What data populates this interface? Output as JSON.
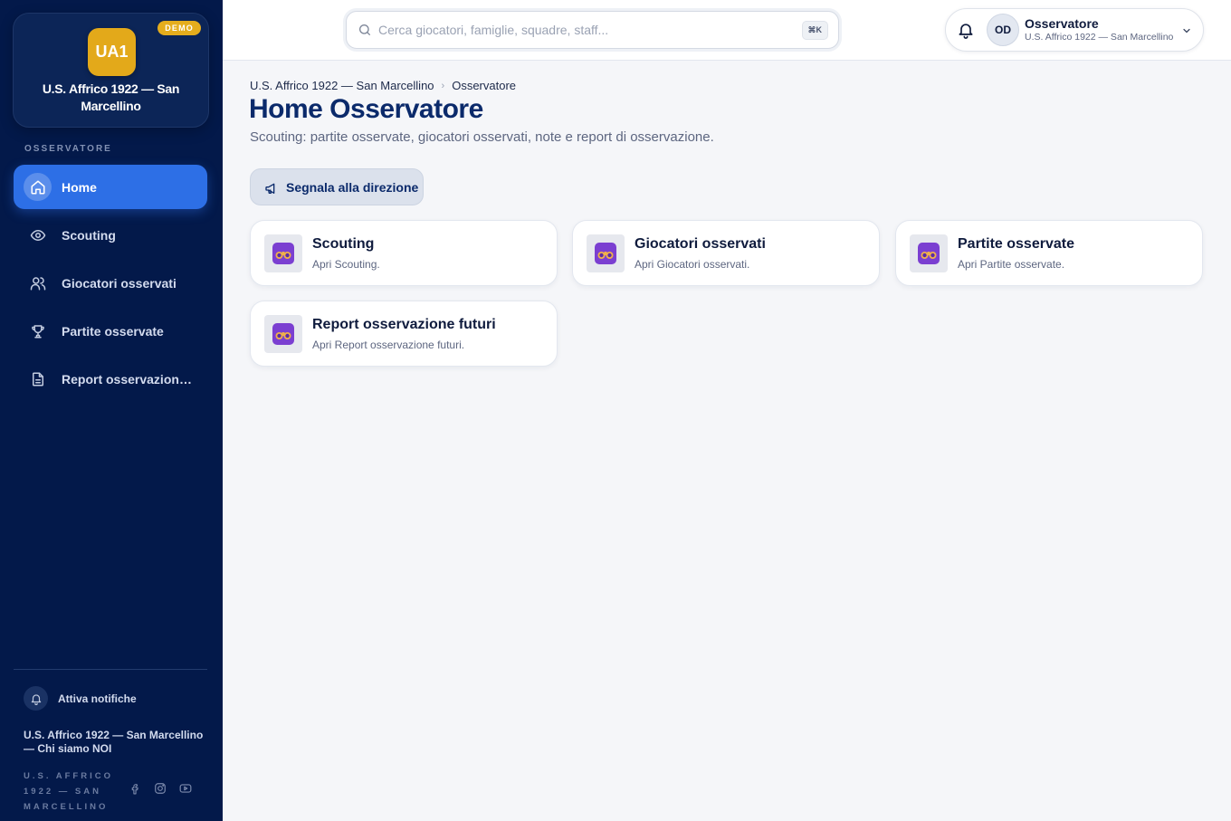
{
  "sidebar": {
    "demo_badge": "DEMO",
    "club_initials": "UA1",
    "club_name": "U.S. Affrico 1922 — San Marcellino",
    "section_label": "OSSERVATORE",
    "items": [
      {
        "label": "Home",
        "icon": "home-icon",
        "active": true
      },
      {
        "label": "Scouting",
        "icon": "eye-icon",
        "active": false
      },
      {
        "label": "Giocatori osservati",
        "icon": "users-icon",
        "active": false
      },
      {
        "label": "Partite osservate",
        "icon": "trophy-icon",
        "active": false
      },
      {
        "label": "Report osservazione futuri",
        "icon": "document-icon",
        "active": false
      }
    ],
    "notifications_label": "Attiva notifiche",
    "about_link": "U.S. Affrico 1922 — San Marcellino — Chi siamo NOI",
    "footer_club": "U.S. AFFRICO 1922 — SAN MARCELLINO",
    "socials": [
      "facebook-icon",
      "instagram-icon",
      "youtube-icon"
    ]
  },
  "topbar": {
    "search_placeholder": "Cerca giocatori, famiglie, squadre, staff...",
    "search_shortcut": "⌘K",
    "user_initials": "OD",
    "user_role": "Osservatore",
    "user_club": "U.S. Affrico 1922 — San Marcellino"
  },
  "main": {
    "breadcrumb": [
      "U.S. Affrico 1922 — San Marcellino",
      "Osservatore"
    ],
    "title": "Home Osservatore",
    "subtitle": "Scouting: partite osservate, giocatori osservati, note e report di osservazione.",
    "report_button": "Segnala alla direzione",
    "cards": [
      {
        "title": "Scouting",
        "description": "Apri Scouting.",
        "icon": "binoculars-icon"
      },
      {
        "title": "Giocatori osservati",
        "description": "Apri Giocatori osservati.",
        "icon": "binoculars-icon"
      },
      {
        "title": "Partite osservate",
        "description": "Apri Partite osservate.",
        "icon": "binoculars-icon"
      },
      {
        "title": "Report osservazione futuri",
        "description": "Apri Report osservazione futuri.",
        "icon": "binoculars-icon"
      }
    ]
  },
  "colors": {
    "sidebar_bg": "#03194a",
    "active_item": "#2d6fe6",
    "club_gold": "#e3a91a",
    "title_navy": "#0b2a6b"
  }
}
